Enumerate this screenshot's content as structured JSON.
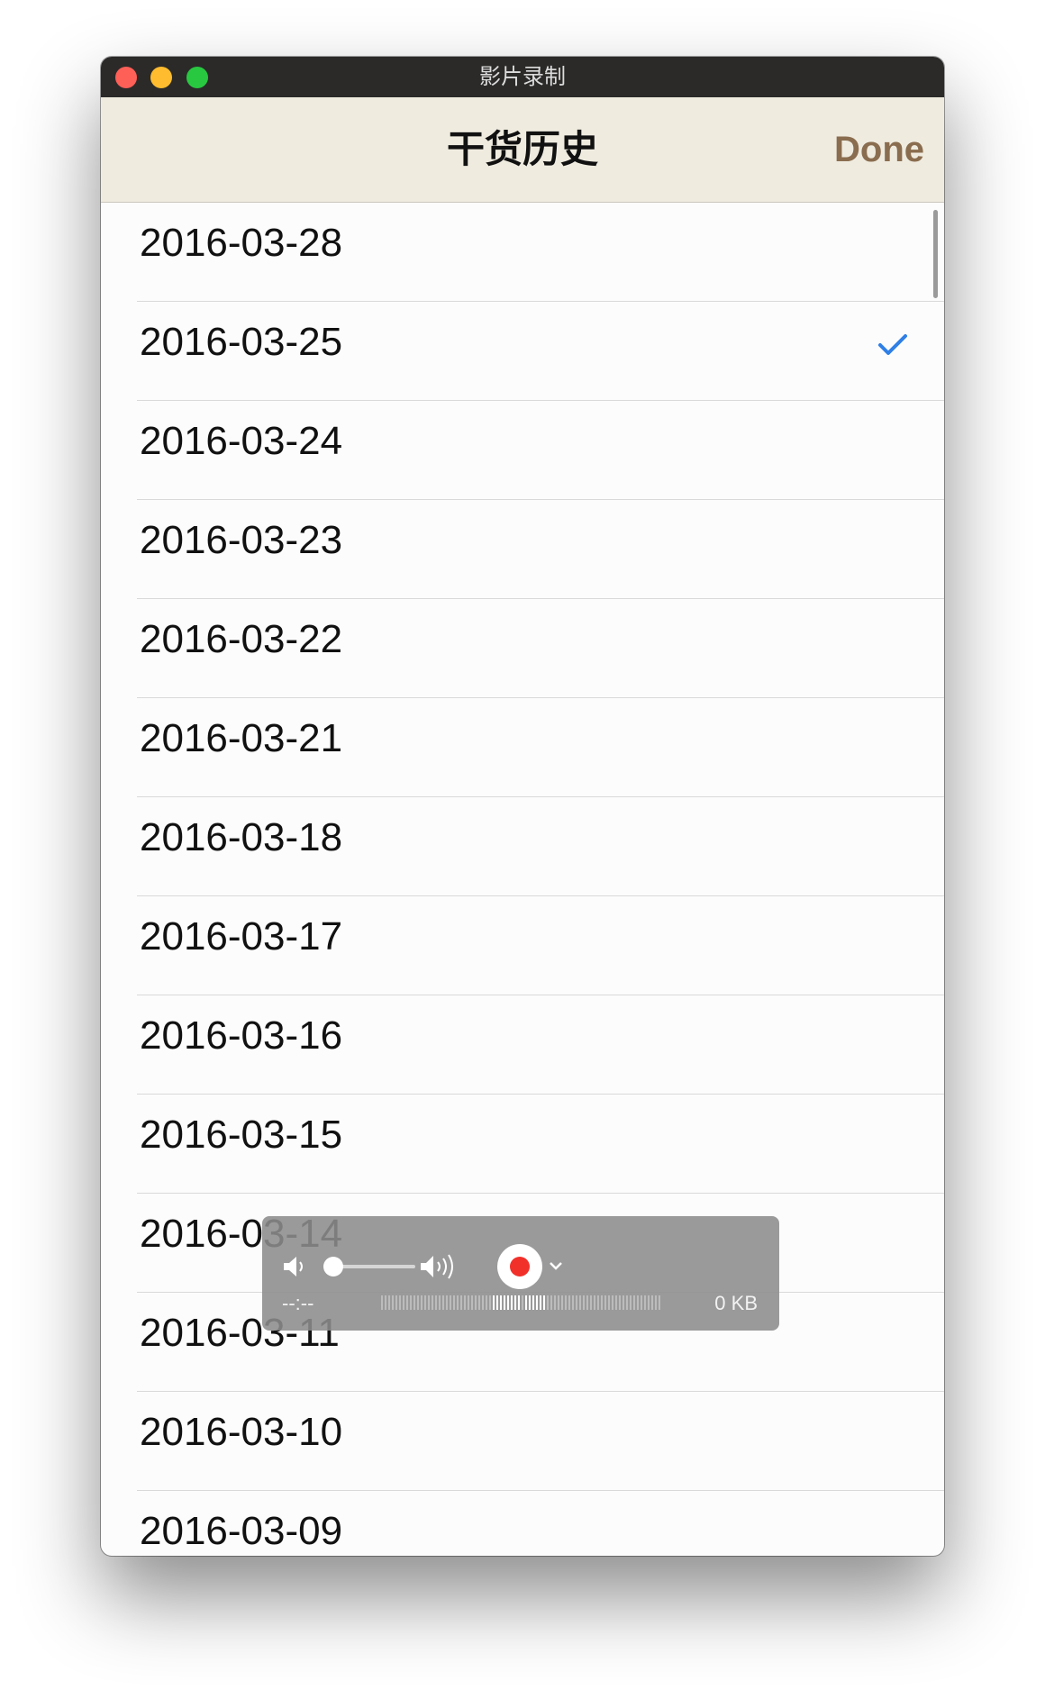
{
  "window": {
    "title": "影片录制"
  },
  "navbar": {
    "title": "干货历史",
    "done_label": "Done"
  },
  "list": {
    "items": [
      {
        "label": "2016-03-28",
        "selected": false
      },
      {
        "label": "2016-03-25",
        "selected": true
      },
      {
        "label": "2016-03-24",
        "selected": false
      },
      {
        "label": "2016-03-23",
        "selected": false
      },
      {
        "label": "2016-03-22",
        "selected": false
      },
      {
        "label": "2016-03-21",
        "selected": false
      },
      {
        "label": "2016-03-18",
        "selected": false
      },
      {
        "label": "2016-03-17",
        "selected": false
      },
      {
        "label": "2016-03-16",
        "selected": false
      },
      {
        "label": "2016-03-15",
        "selected": false
      },
      {
        "label": "2016-03-14",
        "selected": false
      },
      {
        "label": "2016-03-11",
        "selected": false
      },
      {
        "label": "2016-03-10",
        "selected": false
      },
      {
        "label": "2016-03-09",
        "selected": false
      }
    ]
  },
  "recorder": {
    "elapsed": "--:--",
    "file_size": "0 KB",
    "volume_level": 0
  },
  "icons": {
    "checkmark": "checkmark-icon",
    "volume_low": "speaker-low-icon",
    "volume_high": "speaker-high-icon",
    "record": "record-icon",
    "options": "chevron-down-icon"
  },
  "colors": {
    "accent": "#8a6d4f",
    "checkmark": "#2f7fe6",
    "record": "#f2302a",
    "navbar_bg": "#efebdf",
    "titlebar_bg": "#2b2a29"
  }
}
